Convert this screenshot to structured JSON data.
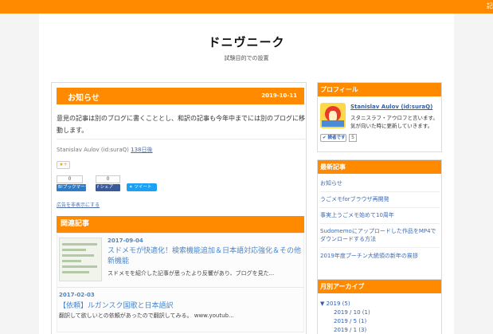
{
  "topbar": {
    "right_text": "記"
  },
  "blog": {
    "title": "ドニヴニーク",
    "description": "試験目的での設置"
  },
  "entry": {
    "title": "お知らせ",
    "date": "2019-10-11",
    "body": "意見の記事は別のブログに書くこととし、和訳の記事も今年中までには別のブログに移動します。",
    "author": "Stanislav Aulov (id:suraQ)",
    "elapsed": "138日後",
    "star_label": "★+",
    "hatena_count": "0",
    "hatena_label": "B!ブックマーク",
    "fb_count": "0",
    "fb_label": "f シェア",
    "tweet_label": "ツイート",
    "hide_ads": "広告を非表示にする"
  },
  "related": {
    "heading": "関連記事",
    "items": [
      {
        "date": "2017-09-04",
        "title": "スドメモが快適化！検索機能追加＆日本語対応強化＆その他新機能",
        "excerpt": "スドメモを紹介した記事が思ったより反響があり、ブログを見た..."
      },
      {
        "date": "2017-02-03",
        "title": "【依頼】ルガンスク国歌と日本語訳",
        "excerpt": "翻訳して欲しいとの依頼があったので翻訳してみる。 www.youtub..."
      }
    ]
  },
  "sidebar": {
    "profile": {
      "heading": "プロフィール",
      "name": "Stanislav Aulov (id:suraQ)",
      "desc": "スタニスラフ・アウロフと言います。気が向いた時に更新していきます。",
      "reader_label": "読者です",
      "reader_count": "5"
    },
    "recent": {
      "heading": "最新記事",
      "items": [
        "お知らせ",
        "うごメモforブラウザ再開発",
        "事実上うごメモ始めて10周年",
        "Sudomemoにアップロードした作品をMP4でダウンロードする方法",
        "2019年度プーチン大統領の新年の挨拶"
      ]
    },
    "archive": {
      "heading": "月別アーカイブ",
      "year": "▼ 2019 (5)",
      "months": [
        "2019 / 10 (1)",
        "2019 / 5 (1)",
        "2019 / 1 (3)"
      ]
    }
  }
}
